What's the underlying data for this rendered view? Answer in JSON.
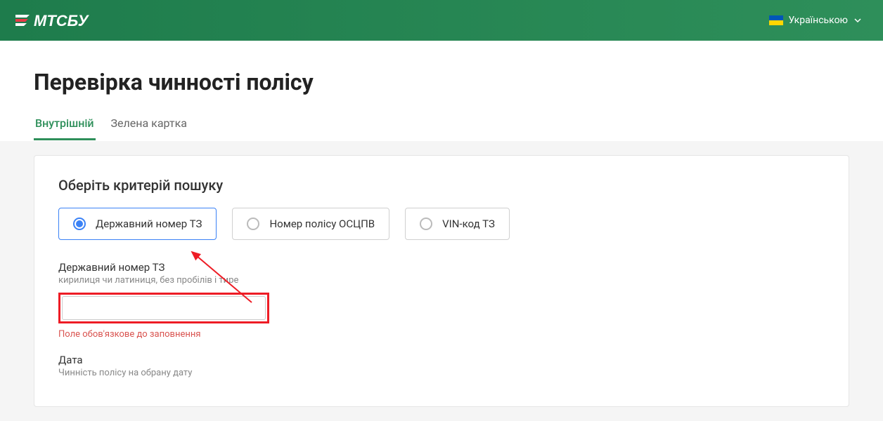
{
  "header": {
    "logo_text": "МТСБУ",
    "language": {
      "label": "Українською"
    }
  },
  "page": {
    "title": "Перевірка чинності полісу"
  },
  "tabs": {
    "items": [
      {
        "label": "Внутрішній",
        "active": true
      },
      {
        "label": "Зелена картка",
        "active": false
      }
    ]
  },
  "form": {
    "section_title": "Оберіть критерій пошуку",
    "criteria": [
      {
        "label": "Державний номер ТЗ",
        "selected": true
      },
      {
        "label": "Номер полісу ОСЦПВ",
        "selected": false
      },
      {
        "label": "VIN-код ТЗ",
        "selected": false
      }
    ],
    "plate": {
      "label": "Державний номер ТЗ",
      "hint": "кирилиця чи латиниця, без пробілів і тире",
      "value": "",
      "error": "Поле обов'язкове до заповнення"
    },
    "date": {
      "label": "Дата",
      "hint": "Чинність полісу на обрану дату"
    }
  }
}
